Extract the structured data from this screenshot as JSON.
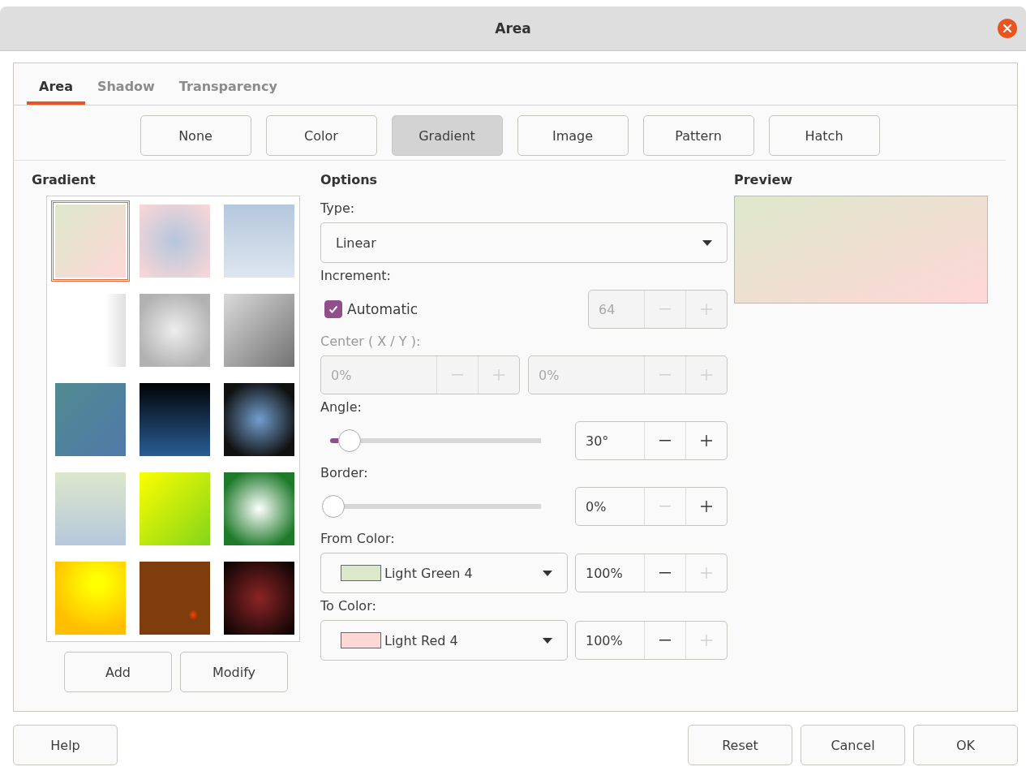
{
  "window": {
    "title": "Area"
  },
  "tabs": [
    {
      "label": "Area",
      "selected": true
    },
    {
      "label": "Shadow",
      "selected": false
    },
    {
      "label": "Transparency",
      "selected": false
    }
  ],
  "fill_types": [
    {
      "label": "None",
      "selected": false
    },
    {
      "label": "Color",
      "selected": false
    },
    {
      "label": "Gradient",
      "selected": true
    },
    {
      "label": "Image",
      "selected": false
    },
    {
      "label": "Pattern",
      "selected": false
    },
    {
      "label": "Hatch",
      "selected": false
    }
  ],
  "gradient": {
    "heading": "Gradient",
    "swatches": [
      {
        "kind": "diagonal",
        "selected": true
      },
      {
        "kind": "square",
        "selected": false
      },
      {
        "kind": "vertical",
        "selected": false
      },
      {
        "kind": "axial",
        "selected": false
      },
      {
        "kind": "radial",
        "selected": false
      },
      {
        "kind": "diagonal",
        "selected": false
      },
      {
        "kind": "diagonal",
        "selected": false
      },
      {
        "kind": "vertical",
        "selected": false
      },
      {
        "kind": "radial",
        "selected": false
      },
      {
        "kind": "vertical",
        "selected": false
      },
      {
        "kind": "diagonal",
        "selected": false
      },
      {
        "kind": "radial",
        "selected": false
      },
      {
        "kind": "radial-offset",
        "selected": false
      },
      {
        "kind": "diamond-offset",
        "selected": false
      },
      {
        "kind": "square",
        "selected": false
      }
    ],
    "buttons": [
      "Add",
      "Modify"
    ]
  },
  "options": {
    "heading": "Options",
    "type": {
      "label": "Type:",
      "value": "Linear"
    },
    "increment": {
      "label": "Increment:",
      "checkbox_label": "Automatic",
      "checked": true,
      "spin": {
        "value": "64",
        "disabled": true,
        "minus_disabled": true,
        "plus_disabled": true
      }
    },
    "center": {
      "label": "Center ( X / Y ):",
      "disabled": true,
      "x": {
        "value": "0%",
        "disabled": true,
        "minus_disabled": true,
        "plus_disabled": true
      },
      "y": {
        "value": "0%",
        "disabled": true,
        "minus_disabled": true,
        "plus_disabled": true
      }
    },
    "angle": {
      "label": "Angle:",
      "level": 0.08,
      "spin": {
        "value": "30°",
        "disabled": false,
        "minus_disabled": false,
        "plus_disabled": false
      }
    },
    "border": {
      "label": "Border:",
      "level": 0,
      "spin": {
        "value": "0%",
        "disabled": false,
        "minus_disabled": true,
        "plus_disabled": false
      }
    },
    "from_color": {
      "label": "From Color:",
      "name": "Light Green 4",
      "color": "#dde8cb",
      "spin": {
        "value": "100%",
        "disabled": false,
        "minus_disabled": false,
        "plus_disabled": true
      }
    },
    "to_color": {
      "label": "To Color:",
      "name": "Light Red 4",
      "color": "#ffd7d7",
      "spin": {
        "value": "100%",
        "disabled": false,
        "minus_disabled": false,
        "plus_disabled": true
      }
    }
  },
  "preview": {
    "heading": "Preview"
  },
  "footer": {
    "left": [
      "Help"
    ],
    "right": [
      "Reset",
      "Cancel",
      "OK"
    ]
  }
}
